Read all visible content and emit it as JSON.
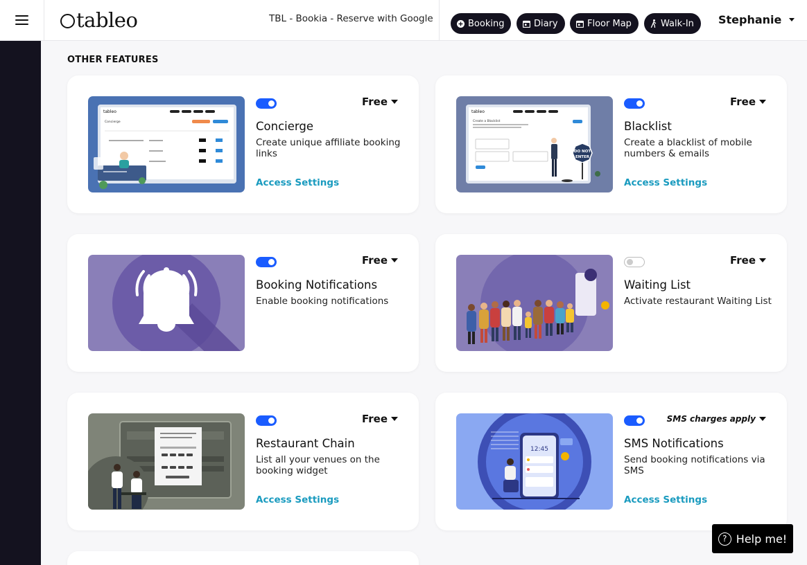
{
  "header": {
    "logo_text": "tableo",
    "venue": "TBL - Bookia - Reserve with Google",
    "nav": [
      {
        "label": "Booking",
        "icon": "plus-circle-icon"
      },
      {
        "label": "Diary",
        "icon": "calendar-icon"
      },
      {
        "label": "Floor Map",
        "icon": "calendar-icon"
      },
      {
        "label": "Walk-In",
        "icon": "walking-person-icon"
      }
    ],
    "user": "Stephanie"
  },
  "section": {
    "title": "OTHER FEATURES"
  },
  "cards": [
    {
      "title": "Concierge",
      "desc": "Create unique affiliate booking links",
      "price": "Free",
      "enabled": true,
      "access": "Access Settings"
    },
    {
      "title": "Blacklist",
      "desc": "Create a blacklist of mobile numbers & emails",
      "price": "Free",
      "enabled": true,
      "access": "Access Settings"
    },
    {
      "title": "Booking Notifications",
      "desc": "Enable booking notifications",
      "price": "Free",
      "enabled": true,
      "access": ""
    },
    {
      "title": "Waiting List",
      "desc": "Activate restaurant Waiting List",
      "price": "Free",
      "enabled": false,
      "access": ""
    },
    {
      "title": "Restaurant Chain",
      "desc": "List all your venues on the booking widget",
      "price": "Free",
      "enabled": true,
      "access": "Access Settings"
    },
    {
      "title": "SMS Notifications",
      "desc": "Send booking notifications via SMS",
      "price": "SMS charges apply",
      "enabled": true,
      "access": "Access Settings"
    }
  ],
  "thumbs": {
    "concierge_screen": {
      "brand": "tableo",
      "heading": "Concierge"
    },
    "blacklist_screen": {
      "brand": "tableo",
      "heading": "Create a Blacklist",
      "sign_line1": "DO NOT",
      "sign_line2": "ENTER"
    },
    "sms_phone": {
      "time": "12:45"
    }
  },
  "help": {
    "label": "Help me!"
  },
  "colors": {
    "sidebar": "#14121f",
    "accent": "#1a5cff",
    "link": "#1a9bbf"
  }
}
